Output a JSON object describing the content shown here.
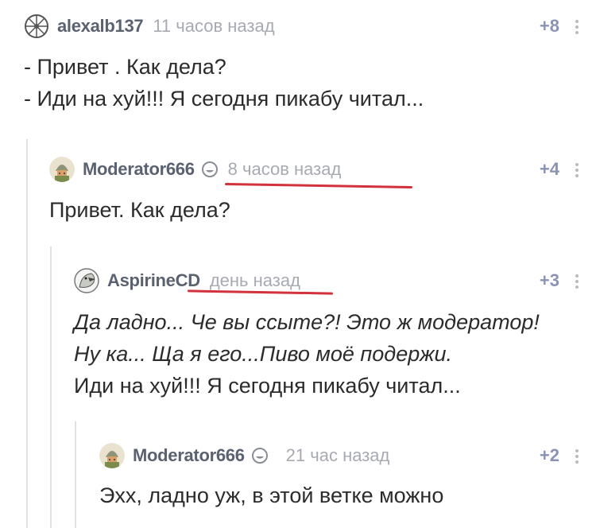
{
  "colors": {
    "nick": "#5a6170",
    "time": "#a7aab1",
    "rating": "#8b93b5",
    "text": "#2b2b2b",
    "thread_line": "#dfe1e6",
    "annotation_underline": "#d2323c"
  },
  "comments": [
    {
      "nick": "alexalb137",
      "time": "11 часов назад",
      "rating": "+8",
      "avatar_icon": "wheel-avatar",
      "lines": [
        "- Привет . Как дела?",
        "- Иди на хуй!!! Я сегодня пикабу читал..."
      ]
    },
    {
      "nick": "Moderator666",
      "time": "8 часов назад",
      "rating": "+4",
      "avatar_icon": "knight-avatar",
      "badge_icon": "moon-badge-icon",
      "lines": [
        "Привет. Как дела?"
      ]
    },
    {
      "nick": "AspirineCD",
      "time": "день назад",
      "rating": "+3",
      "avatar_icon": "parrot-avatar",
      "lines": [
        "Да ладно... Че вы ссыте?! Это ж модератор!",
        "Ну ка... Ща я его...Пиво моё подержи.",
        "Иди на хуй!!! Я сегодня пикабу читал..."
      ]
    },
    {
      "nick": "Moderator666",
      "time": "21 час назад",
      "rating": "+2",
      "avatar_icon": "knight-avatar",
      "badge_icon": "moon-badge-icon",
      "lines": [
        "Эхх, ладно уж, в этой ветке можно"
      ]
    }
  ]
}
